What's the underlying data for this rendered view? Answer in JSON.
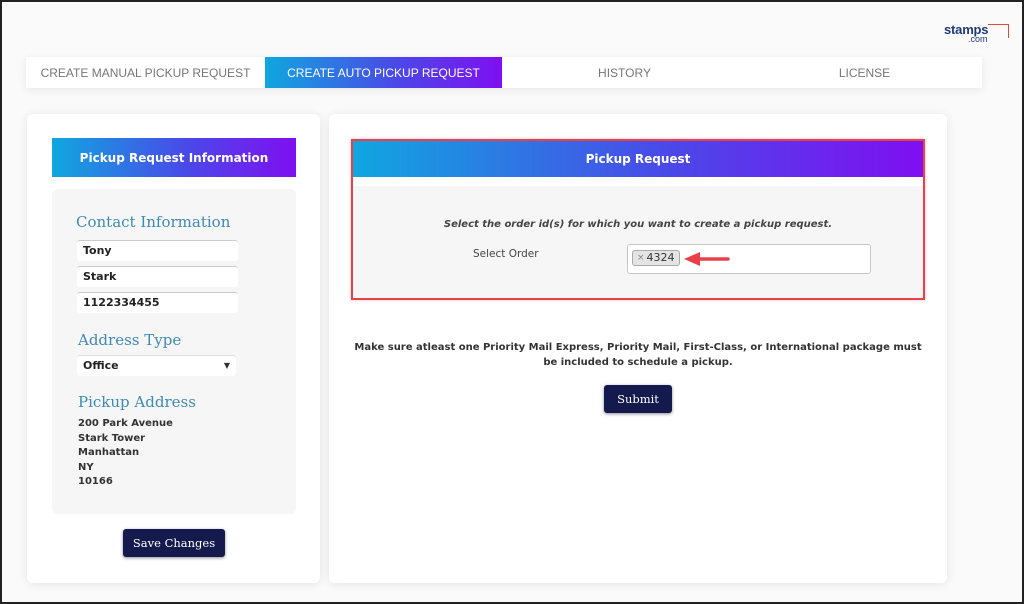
{
  "brand": {
    "name_main": "stamps",
    "name_suffix": ".com"
  },
  "tabs": [
    {
      "label": "CREATE MANUAL PICKUP REQUEST",
      "active": false
    },
    {
      "label": "CREATE AUTO PICKUP REQUEST",
      "active": true
    },
    {
      "label": "HISTORY",
      "active": false
    },
    {
      "label": "LICENSE",
      "active": false
    }
  ],
  "left": {
    "header": "Pickup Request Information",
    "contact_title": "Contact Information",
    "first_name": "Tony",
    "last_name": "Stark",
    "phone": "1122334455",
    "address_type_title": "Address Type",
    "address_type_value": "Office",
    "address_type_arrow": "▼",
    "pickup_address_title": "Pickup Address",
    "address_lines": [
      "200 Park Avenue",
      "Stark Tower",
      "Manhattan",
      "NY",
      "10166"
    ],
    "save_label": "Save Changes"
  },
  "right": {
    "header": "Pickup Request",
    "instruction": "Select the order id(s) for which you want to create a pickup request.",
    "select_label": "Select Order",
    "selected_orders": [
      {
        "id": "4324",
        "remove_glyph": "×"
      }
    ],
    "note": "Make sure atleast one Priority Mail Express, Priority Mail, First-Class, or International package must be included to schedule a pickup.",
    "submit_label": "Submit"
  },
  "colors": {
    "gradient_start": "#10a7df",
    "gradient_end": "#7f0ff1",
    "button_navy": "#141a4d",
    "section_title": "#3d8ab5",
    "highlight_red": "#e8414a"
  }
}
